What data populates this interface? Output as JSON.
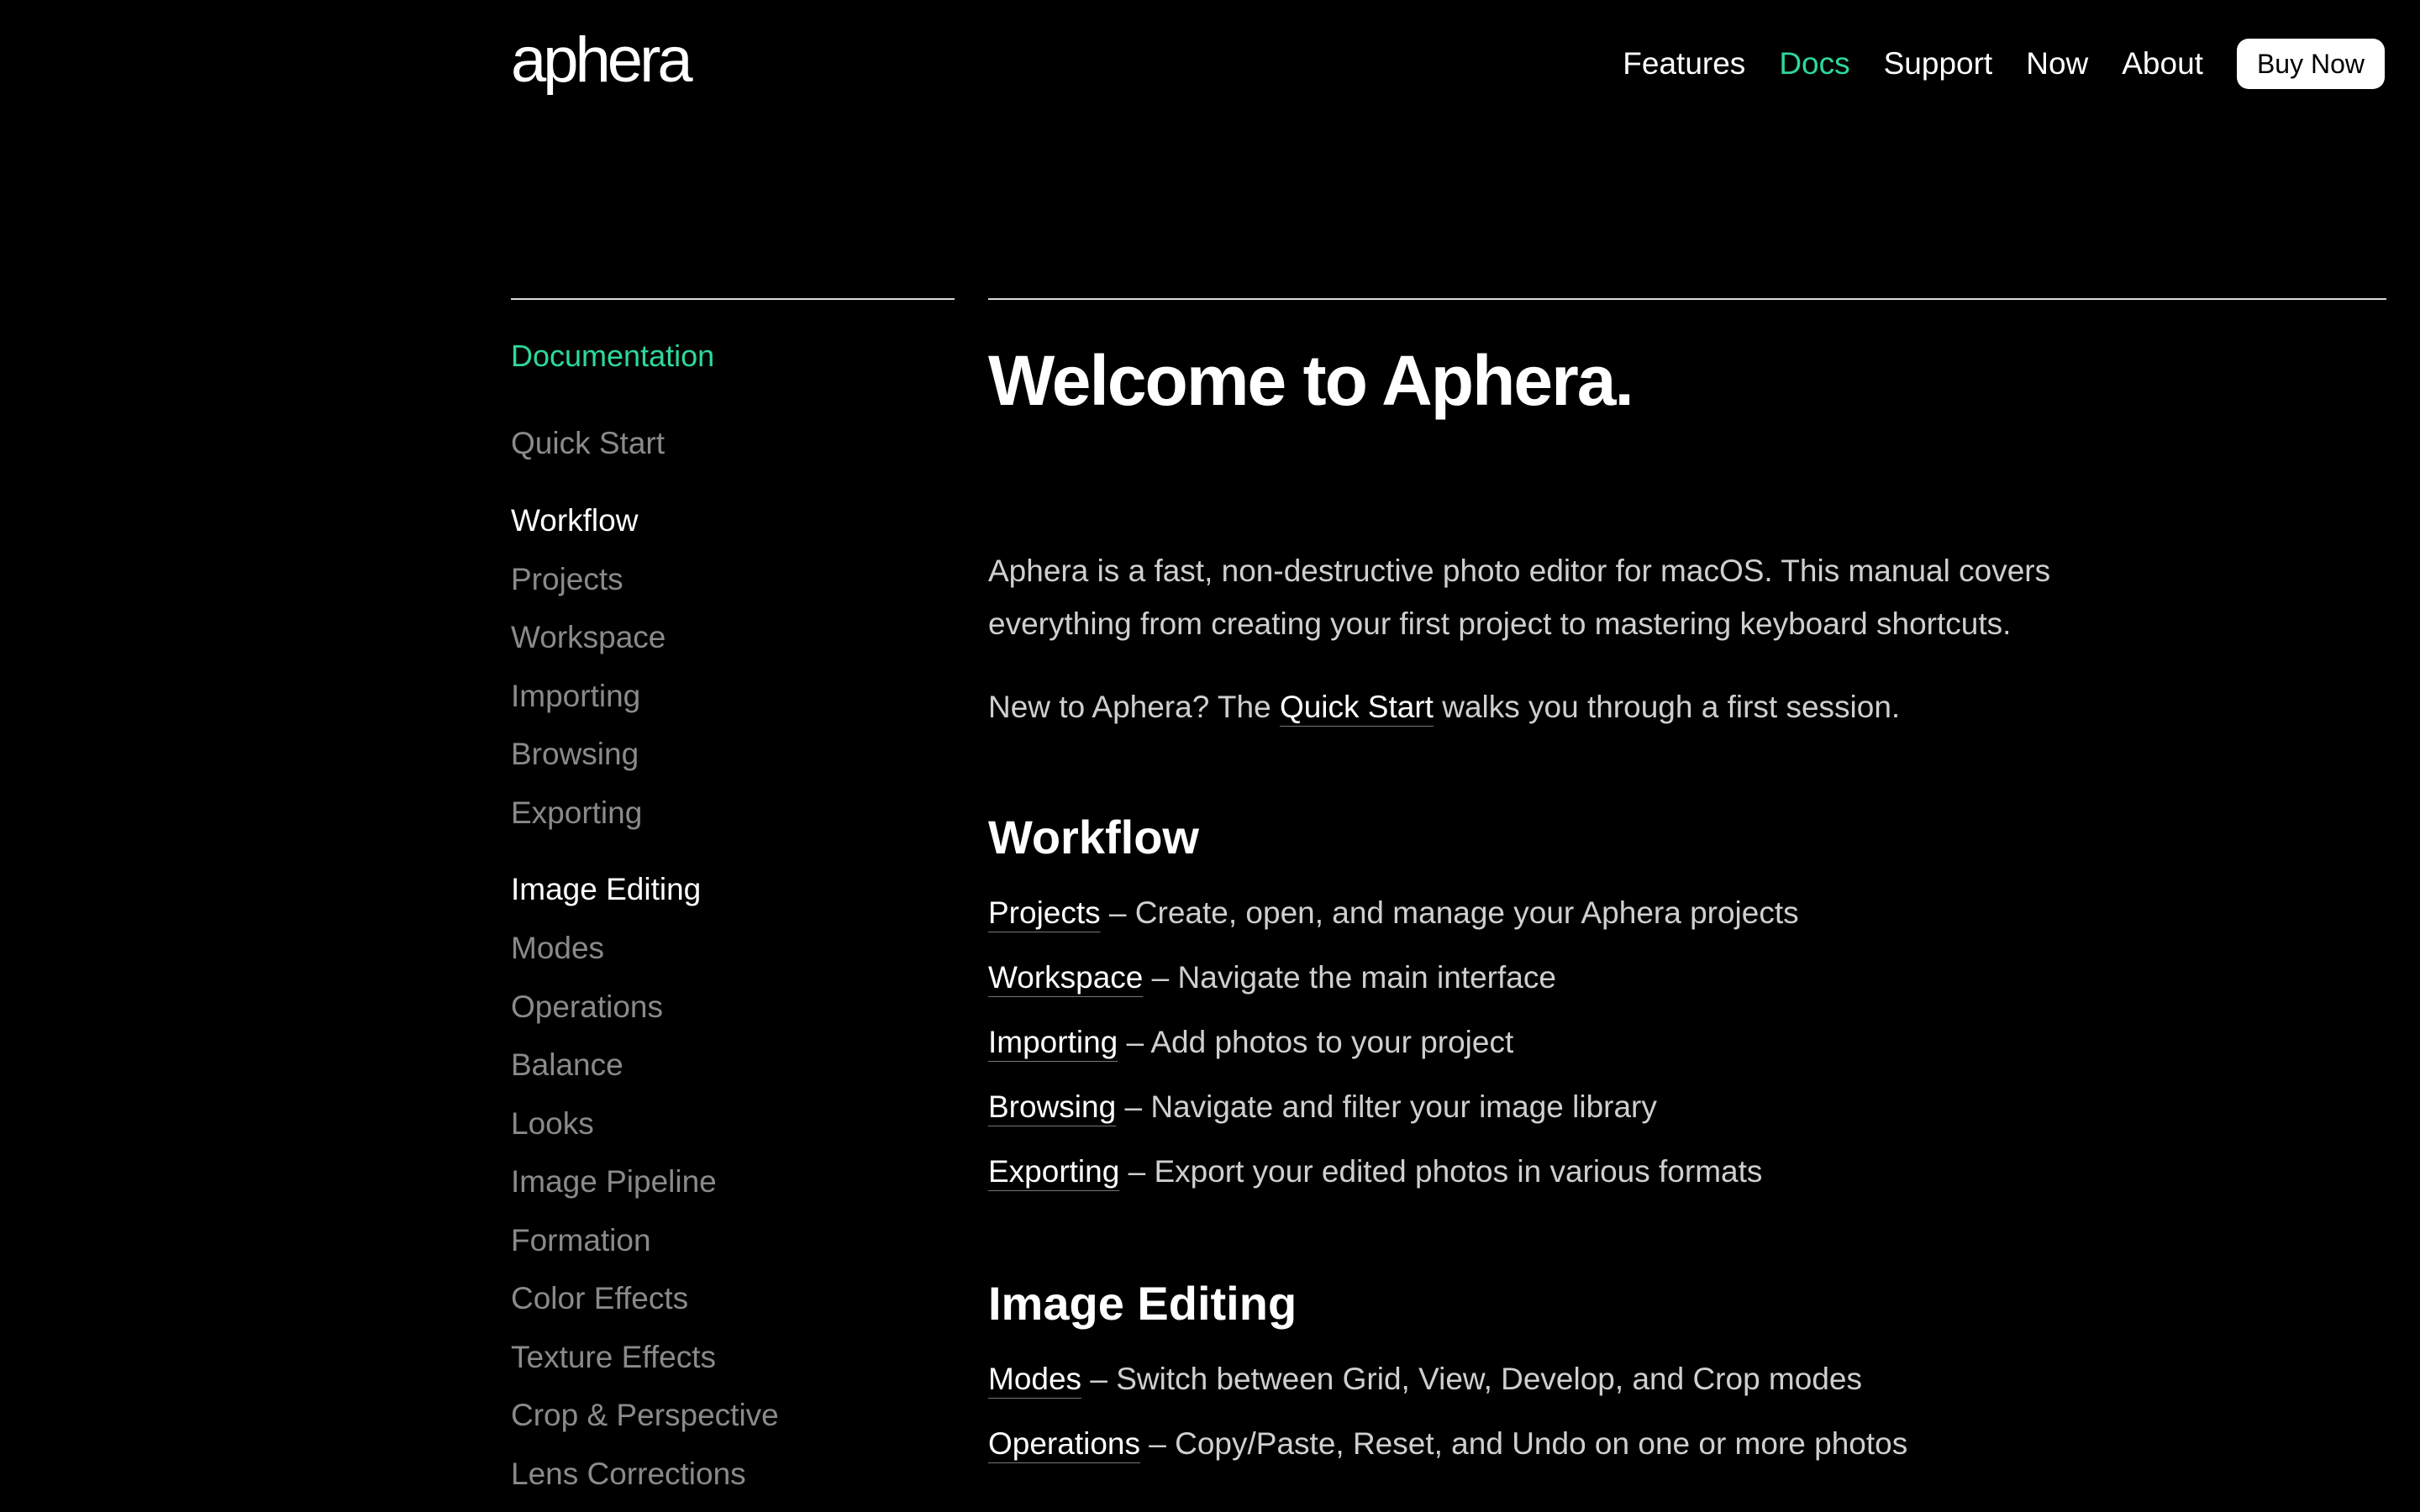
{
  "header": {
    "logo": "aphera",
    "nav": [
      {
        "label": "Features",
        "active": false
      },
      {
        "label": "Docs",
        "active": true
      },
      {
        "label": "Support",
        "active": false
      },
      {
        "label": "Now",
        "active": false
      },
      {
        "label": "About",
        "active": false
      }
    ],
    "buy_label": "Buy Now"
  },
  "sidebar": {
    "title": "Documentation",
    "quick_start": "Quick Start",
    "workflow": {
      "heading": "Workflow",
      "items": [
        "Projects",
        "Workspace",
        "Importing",
        "Browsing",
        "Exporting"
      ]
    },
    "image_editing": {
      "heading": "Image Editing",
      "items": [
        "Modes",
        "Operations",
        "Balance",
        "Looks",
        "Image Pipeline",
        "Formation",
        "Color Effects",
        "Texture Effects",
        "Crop & Perspective",
        "Lens Corrections"
      ]
    }
  },
  "main": {
    "title": "Welcome to Aphera.",
    "intro": "Aphera is a fast, non-destructive photo editor for macOS. This manual covers everything from creating your first project to mastering keyboard shortcuts.",
    "new_prefix": "New to Aphera? The ",
    "new_link": "Quick Start",
    "new_suffix": " walks you through a first session.",
    "workflow": {
      "heading": "Workflow",
      "items": [
        {
          "link": "Projects",
          "desc": " – Create, open, and manage your Aphera projects"
        },
        {
          "link": "Workspace",
          "desc": " – Navigate the main interface"
        },
        {
          "link": "Importing",
          "desc": " – Add photos to your project"
        },
        {
          "link": "Browsing",
          "desc": " – Navigate and filter your image library"
        },
        {
          "link": "Exporting",
          "desc": " – Export your edited photos in various formats"
        }
      ]
    },
    "image_editing": {
      "heading": "Image Editing",
      "items": [
        {
          "link": "Modes",
          "desc": " – Switch between Grid, View, Develop, and Crop modes"
        },
        {
          "link": "Operations",
          "desc": " – Copy/Paste, Reset, and Undo on one or more photos"
        }
      ]
    }
  },
  "colors": {
    "accent": "#2ed89a",
    "background": "#000000",
    "muted": "#8a8a8a"
  }
}
